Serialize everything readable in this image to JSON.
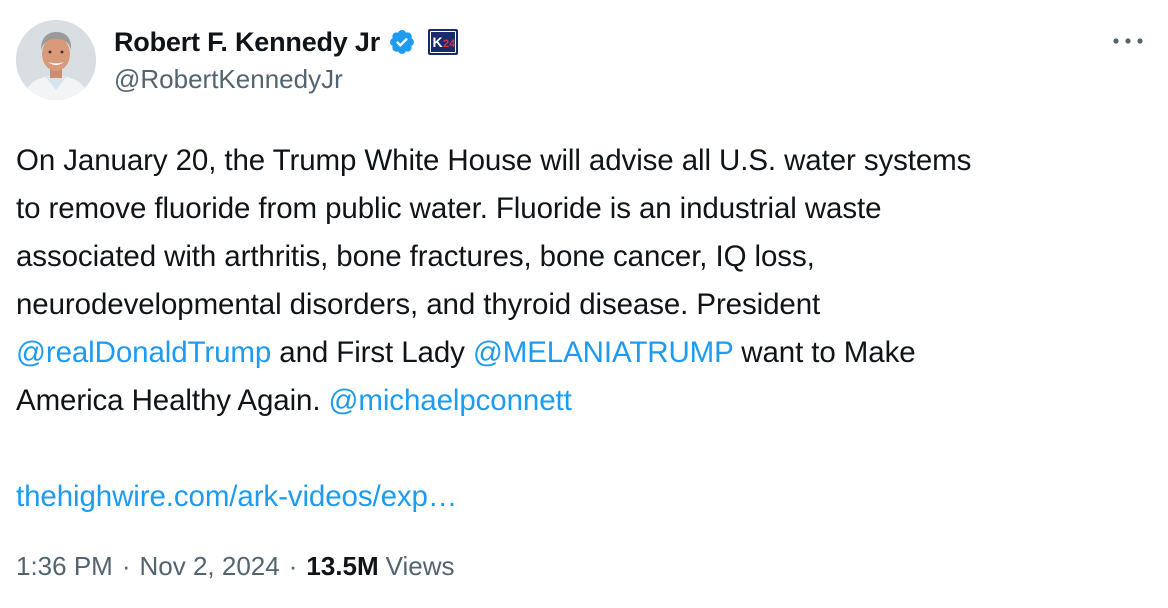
{
  "author": {
    "display_name": "Robert F. Kennedy Jr",
    "handle": "@RobertKennedyJr",
    "affiliate_badge_text": "K24",
    "verified_color": "#1d9bf0"
  },
  "tweet": {
    "lines": [
      [
        {
          "t": "On January 20, the Trump White House will advise all U.S. water systems"
        }
      ],
      [
        {
          "t": "to remove fluoride from public water. Fluoride is an industrial waste"
        }
      ],
      [
        {
          "t": "associated with arthritis, bone fractures, bone cancer, IQ loss,"
        }
      ],
      [
        {
          "t": "neurodevelopmental disorders, and thyroid disease. President"
        }
      ],
      [
        {
          "t": "@realDonaldTrump",
          "k": "mention"
        },
        {
          "t": " and First Lady "
        },
        {
          "t": "@MELANIATRUMP",
          "k": "mention"
        },
        {
          "t": " want to Make"
        }
      ],
      [
        {
          "t": "America Healthy Again. "
        },
        {
          "t": "@michaelpconnett",
          "k": "mention"
        }
      ],
      [
        {
          "t": ""
        }
      ],
      [
        {
          "t": "thehighwire.com/ark-videos/exp…",
          "k": "link"
        }
      ]
    ]
  },
  "meta": {
    "time": "1:36 PM",
    "separator": "·",
    "date": "Nov 2, 2024",
    "views_count": "13.5M",
    "views_label": "Views"
  },
  "colors": {
    "text": "#0f1419",
    "secondary": "#536471",
    "accent": "#1d9bf0"
  },
  "icons": {
    "more": "more-horizontal-icon",
    "verified": "verified-badge-icon",
    "affiliate": "affiliate-badge-icon"
  }
}
